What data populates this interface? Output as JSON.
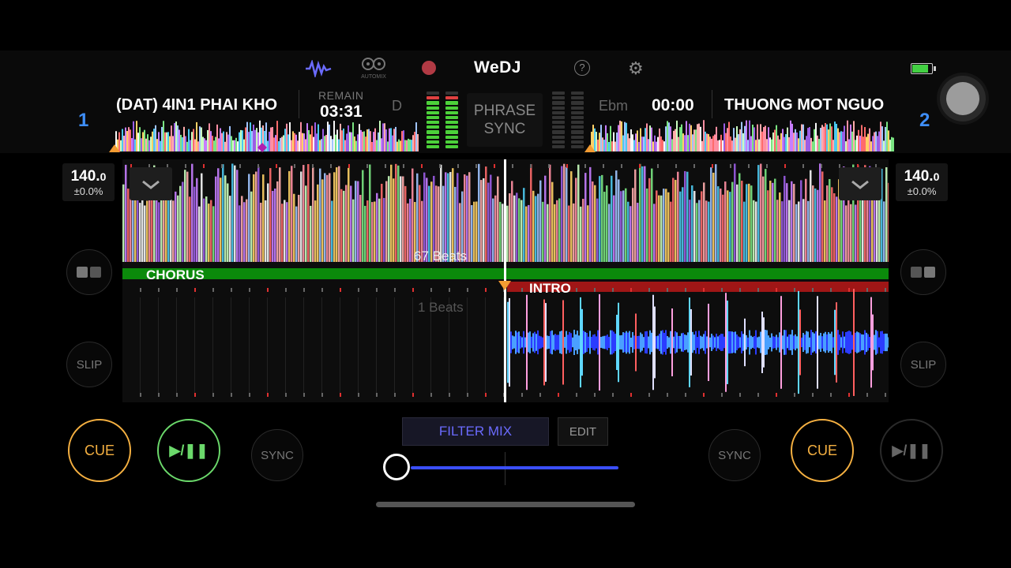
{
  "app": {
    "logo": "WeDJ"
  },
  "toolbar": {
    "waveform_icon": "waveform-icon",
    "automix_label": "AUTOMIX",
    "record_icon": "record-icon",
    "help_label": "?",
    "settings_icon": "gear-icon",
    "battery_level": 0.9,
    "battery_color": "#43d043"
  },
  "deck1": {
    "number": "1",
    "title": "(DAT) 4IN1 PHAI KHO",
    "remain_label": "REMAIN",
    "remain_time": "03:31",
    "key": "D",
    "bpm": "140.",
    "bpm_decimal": "0",
    "pitch": "±0.0%",
    "cue_label": "CUE",
    "play_label": "▶/❚❚",
    "sync_label": "SYNC",
    "slip_label": "SLIP",
    "beats_label": "67 Beats",
    "phrase_label": "CHORUS",
    "phrase_color": "#0b8a0b"
  },
  "deck2": {
    "number": "2",
    "title": "THUONG MOT NGUO",
    "key": "Ebm",
    "time": "00:00",
    "bpm": "140.",
    "bpm_decimal": "0",
    "pitch": "±0.0%",
    "cue_label": "CUE",
    "play_label": "▶/❚❚",
    "sync_label": "SYNC",
    "slip_label": "SLIP",
    "beats_label": "1 Beats",
    "phrase_label": "INTRO",
    "phrase_color": "#a01616"
  },
  "mixer": {
    "phrase_sync_line1": "PHRASE",
    "phrase_sync_line2": "SYNC",
    "filter_mix_label": "FILTER MIX",
    "edit_label": "EDIT",
    "crossfader_position": 0.0
  },
  "colors": {
    "accent_blue": "#3e8ef7",
    "cue": "#f5b041",
    "play": "#6bd96b",
    "filter": "#6b6bff"
  }
}
